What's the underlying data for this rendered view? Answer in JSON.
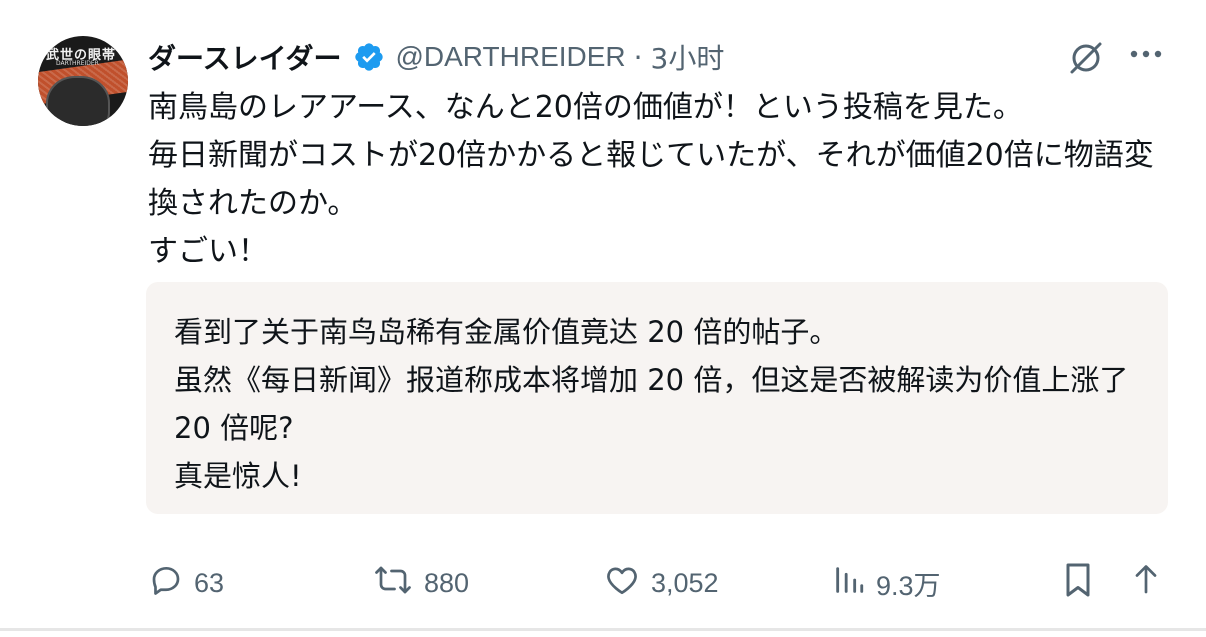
{
  "author": {
    "display_name": "ダースレイダー",
    "handle": "@DARTHREIDER",
    "separator": "·",
    "time": "3小时",
    "avatar": {
      "title": "武世の眼帯",
      "subtitle": "DARTHREIDER"
    }
  },
  "icons": {
    "verified": "verified-badge-icon",
    "grok": "grok-icon",
    "more": "more-options-icon",
    "reply": "reply-icon",
    "repost": "repost-icon",
    "like": "like-icon",
    "views": "views-icon",
    "bookmark": "bookmark-icon",
    "share": "share-icon"
  },
  "colors": {
    "verified": "#1d9bf0",
    "secondary_text": "#536471",
    "quote_bg": "#f7f4f2"
  },
  "post": {
    "lines": [
      "南鳥島のレアアース、なんと20倍の価値が！という投稿を見た。",
      "毎日新聞がコストが20倍かかると報じていたが、それが価値20倍に物語変換されたのか。",
      "すごい！"
    ]
  },
  "translation": {
    "lines": [
      "看到了关于南鸟岛稀有金属价值竟达 20 倍的帖子。",
      "虽然《每日新闻》报道称成本将增加 20 倍，但这是否被解读为价值上涨了 20 倍呢?",
      "真是惊人!"
    ]
  },
  "actions": {
    "replies": "63",
    "reposts": "880",
    "likes": "3,052",
    "views": "9.3万"
  }
}
